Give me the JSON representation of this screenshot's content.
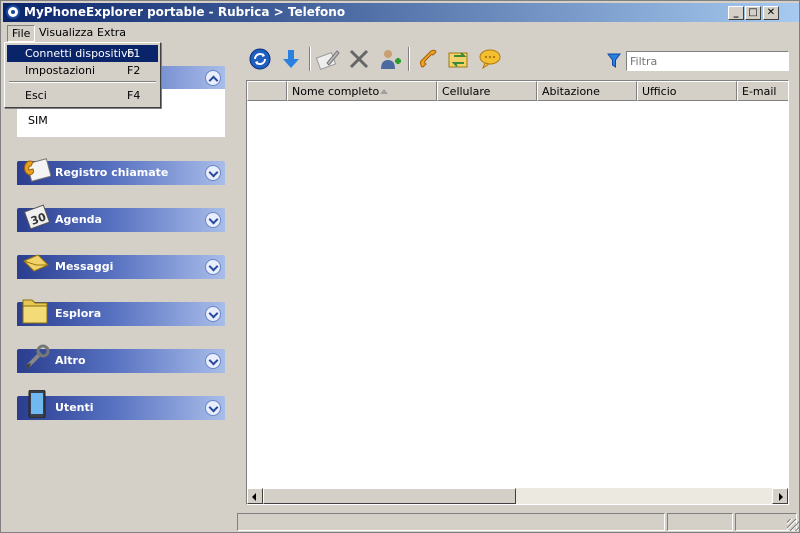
{
  "window": {
    "title": "MyPhoneExplorer portable  -  Rubrica > Telefono",
    "controls": {
      "minimize": "_",
      "maximize": "□",
      "close": "✕"
    }
  },
  "menubar": {
    "items": [
      {
        "label": "File"
      },
      {
        "label": "Visualizza"
      },
      {
        "label": "Extra"
      }
    ]
  },
  "file_menu": {
    "items": [
      {
        "label": "Connetti dispositivo",
        "shortcut": "F1"
      },
      {
        "label": "Impostazioni",
        "shortcut": "F2"
      },
      {
        "label": "Esci",
        "shortcut": "F4"
      }
    ]
  },
  "sidebar": {
    "rubrica_items": [
      {
        "label": "SIM"
      }
    ],
    "groups": [
      {
        "label": "Registro chiamate",
        "icon": "call-log-icon"
      },
      {
        "label": "Agenda",
        "icon": "calendar-icon"
      },
      {
        "label": "Messaggi",
        "icon": "envelope-icon"
      },
      {
        "label": "Esplora",
        "icon": "folder-icon"
      },
      {
        "label": "Altro",
        "icon": "tools-icon"
      },
      {
        "label": "Utenti",
        "icon": "phone-device-icon"
      }
    ]
  },
  "toolbar": {
    "buttons": [
      "refresh-icon",
      "download-icon",
      "edit-icon",
      "delete-icon",
      "add-contact-icon",
      "call-icon",
      "sync-icon",
      "message-icon"
    ]
  },
  "filter": {
    "placeholder": "Filtra"
  },
  "grid": {
    "columns": [
      "",
      "Nome completo",
      "Cellulare",
      "Abitazione",
      "Ufficio",
      "E-mail"
    ]
  },
  "colors": {
    "titlebar_start": "#0a246a",
    "titlebar_end": "#a6caf0",
    "group_header": "#2a3d8f",
    "window_bg": "#d4d0c8"
  }
}
